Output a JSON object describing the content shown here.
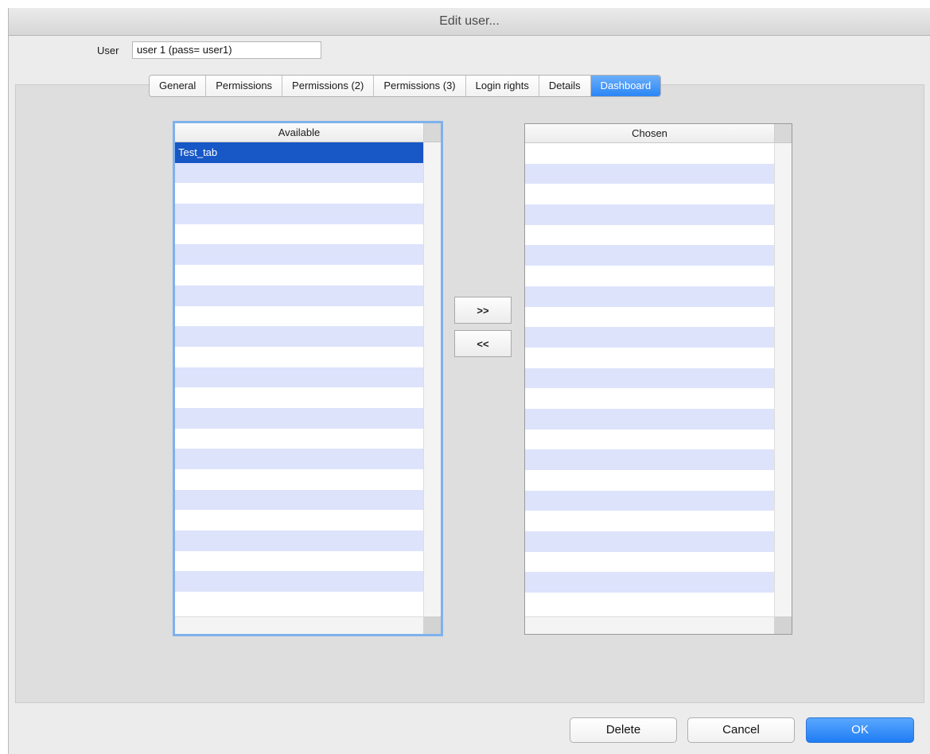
{
  "window": {
    "title": "Edit user..."
  },
  "user": {
    "label": "User",
    "value": "user 1 (pass= user1)"
  },
  "tabs": [
    {
      "label": "General",
      "active": false
    },
    {
      "label": "Permissions",
      "active": false
    },
    {
      "label": "Permissions (2)",
      "active": false
    },
    {
      "label": "Permissions (3)",
      "active": false
    },
    {
      "label": "Login rights",
      "active": false
    },
    {
      "label": "Details",
      "active": false
    },
    {
      "label": "Dashboard",
      "active": true
    }
  ],
  "available": {
    "header": "Available",
    "items": [
      "Test_tab"
    ],
    "selected_index": 0
  },
  "chosen": {
    "header": "Chosen",
    "items": []
  },
  "transfer": {
    "add_label": ">>",
    "remove_label": "<<"
  },
  "buttons": {
    "delete": "Delete",
    "cancel": "Cancel",
    "ok": "OK"
  },
  "colors": {
    "accent": "#2c86f5",
    "selection": "#1757c6",
    "stripe": "#dde3fb"
  }
}
